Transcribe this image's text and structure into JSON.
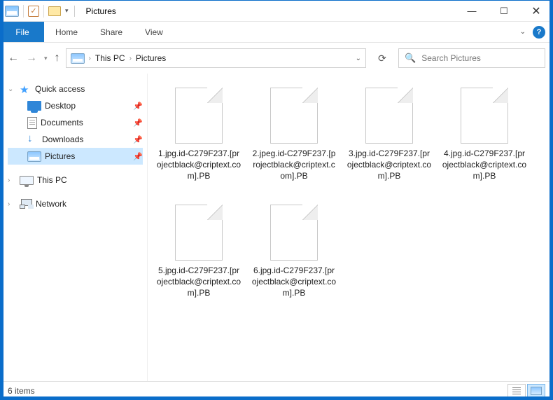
{
  "title": "Pictures",
  "ribbon": {
    "file": "File",
    "tabs": [
      "Home",
      "Share",
      "View"
    ]
  },
  "breadcrumb": [
    "This PC",
    "Pictures"
  ],
  "search": {
    "placeholder": "Search Pictures"
  },
  "sidebar": {
    "quick_access": "Quick access",
    "items": [
      {
        "label": "Desktop"
      },
      {
        "label": "Documents"
      },
      {
        "label": "Downloads"
      },
      {
        "label": "Pictures"
      }
    ],
    "this_pc": "This PC",
    "network": "Network"
  },
  "files": [
    {
      "name": "1.jpg.id-C279F237.[projectblack@criptext.com].PB"
    },
    {
      "name": "2.jpeg.id-C279F237.[projectblack@criptext.com].PB"
    },
    {
      "name": "3.jpg.id-C279F237.[projectblack@criptext.com].PB"
    },
    {
      "name": "4.jpg.id-C279F237.[projectblack@criptext.com].PB"
    },
    {
      "name": "5.jpg.id-C279F237.[projectblack@criptext.com].PB"
    },
    {
      "name": "6.jpg.id-C279F237.[projectblack@criptext.com].PB"
    }
  ],
  "status": "6 items"
}
